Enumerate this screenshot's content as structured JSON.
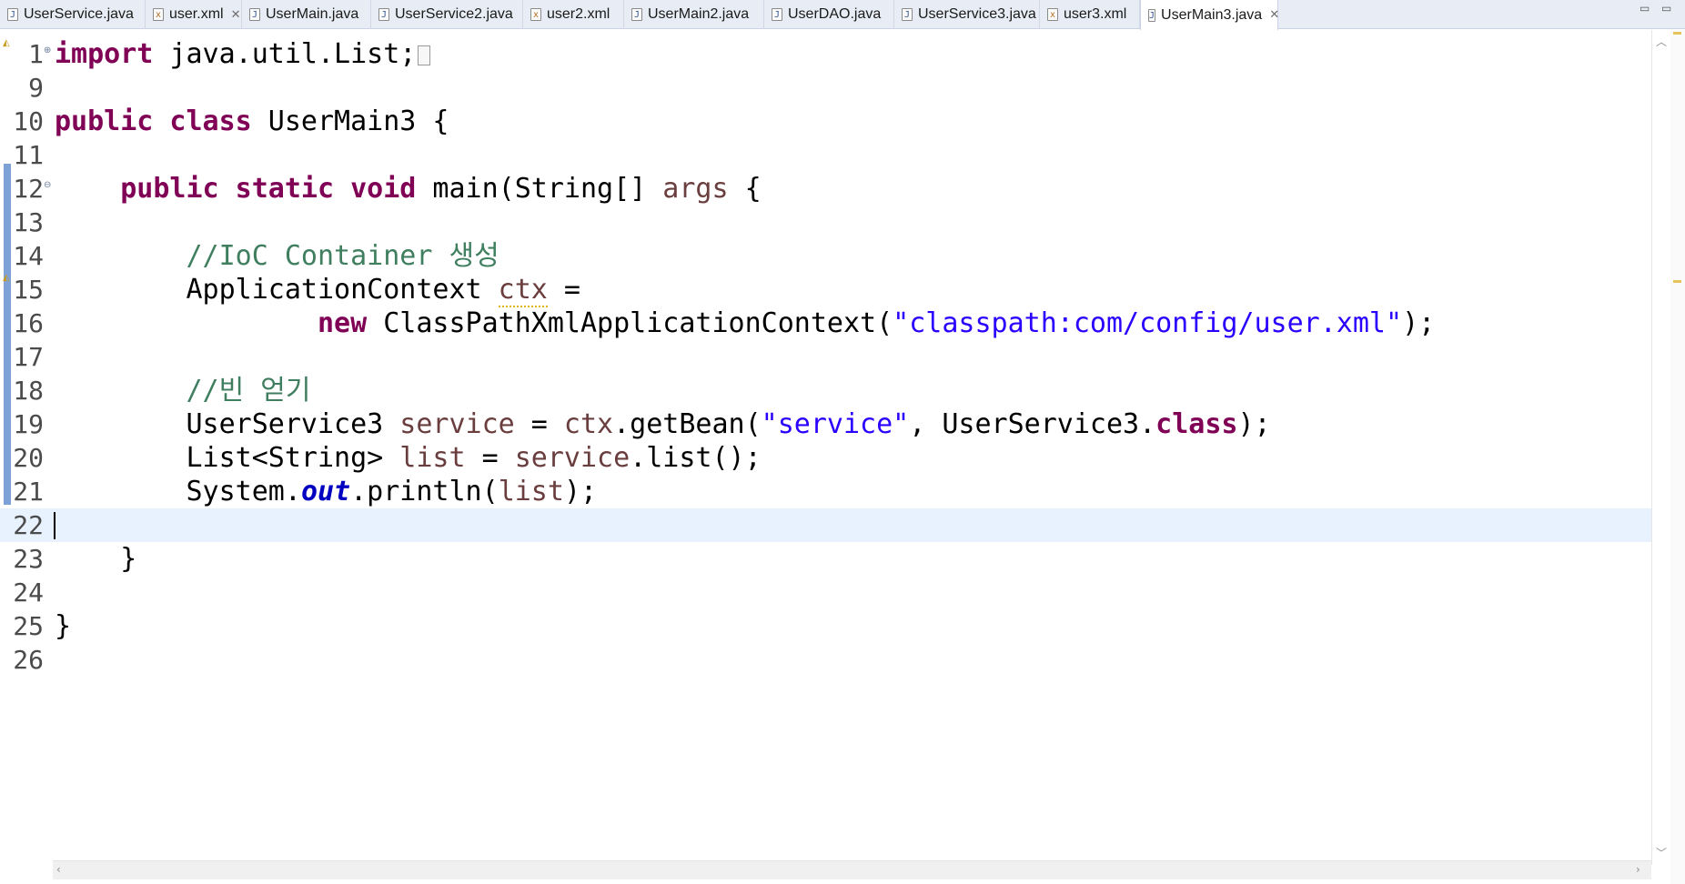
{
  "tabs": [
    {
      "label": "UserService.java",
      "icon": "java-file-icon",
      "active": false
    },
    {
      "label": "user.xml",
      "icon": "xml-file-icon",
      "active": false,
      "close": "✕"
    },
    {
      "label": "UserMain.java",
      "icon": "java-file-icon",
      "active": false
    },
    {
      "label": "UserService2.java",
      "icon": "java-file-icon",
      "active": false
    },
    {
      "label": "user2.xml",
      "icon": "xml-file-icon",
      "active": false
    },
    {
      "label": "UserMain2.java",
      "icon": "java-file-icon",
      "active": false
    },
    {
      "label": "UserDAO.java",
      "icon": "java-file-icon",
      "active": false
    },
    {
      "label": "UserService3.java",
      "icon": "java-file-icon",
      "active": false
    },
    {
      "label": "user3.xml",
      "icon": "xml-file-icon",
      "active": false
    },
    {
      "label": "UserMain3.java",
      "icon": "java-file-icon",
      "active": true,
      "close": "✕"
    }
  ],
  "editor": {
    "current_line": "22",
    "lines": [
      {
        "n": "1",
        "tokens": [
          [
            "kw",
            "import"
          ],
          [
            "",
            "java.util.List;"
          ]
        ]
      },
      {
        "n": "9",
        "tokens": []
      },
      {
        "n": "10",
        "tokens": [
          [
            "kw",
            "public class"
          ],
          [
            "",
            " UserMain3 {"
          ]
        ]
      },
      {
        "n": "11",
        "tokens": []
      },
      {
        "n": "12",
        "tokens": [
          [
            "",
            "    "
          ],
          [
            "kw",
            "public static void"
          ],
          [
            "",
            " main(String[] "
          ],
          [
            "loc",
            "args"
          ],
          [
            "",
            " {"
          ]
        ]
      },
      {
        "n": "13",
        "tokens": []
      },
      {
        "n": "14",
        "tokens": [
          [
            "",
            "        "
          ],
          [
            "cmt",
            "//IoC Container 생성"
          ]
        ]
      },
      {
        "n": "15",
        "tokens": [
          [
            "",
            "        ApplicationContext "
          ],
          [
            "loc warn",
            "ctx"
          ],
          [
            "",
            " ="
          ]
        ]
      },
      {
        "n": "16",
        "tokens": [
          [
            "",
            "                "
          ],
          [
            "kw",
            "new"
          ],
          [
            "",
            " ClassPathXmlApplicationContext("
          ],
          [
            "str",
            "\"classpath:com/config/user.xml\""
          ],
          [
            "",
            ");"
          ]
        ]
      },
      {
        "n": "17",
        "tokens": []
      },
      {
        "n": "18",
        "tokens": [
          [
            "",
            "        "
          ],
          [
            "cmt",
            "//빈 얻기"
          ]
        ]
      },
      {
        "n": "19",
        "tokens": [
          [
            "",
            "        UserService3 "
          ],
          [
            "loc",
            "service"
          ],
          [
            "",
            " = "
          ],
          [
            "loc",
            "ctx"
          ],
          [
            "",
            ".getBean("
          ],
          [
            "str",
            "\"service\""
          ],
          [
            "",
            ", UserService3."
          ],
          [
            "kw",
            "class"
          ],
          [
            "",
            ");"
          ]
        ]
      },
      {
        "n": "20",
        "tokens": [
          [
            "",
            "        List<String> "
          ],
          [
            "loc",
            "list"
          ],
          [
            "",
            " = "
          ],
          [
            "loc",
            "service"
          ],
          [
            "",
            ".list();"
          ]
        ]
      },
      {
        "n": "21",
        "tokens": [
          [
            "",
            "        System."
          ],
          [
            "fld",
            "out"
          ],
          [
            "",
            ".println("
          ],
          [
            "loc",
            "list"
          ],
          [
            "",
            ");"
          ]
        ]
      },
      {
        "n": "22",
        "tokens": []
      },
      {
        "n": "23",
        "tokens": [
          [
            "",
            "    }"
          ]
        ]
      },
      {
        "n": "24",
        "tokens": []
      },
      {
        "n": "25",
        "tokens": [
          [
            "",
            "}"
          ]
        ]
      },
      {
        "n": "26",
        "tokens": []
      }
    ]
  },
  "colors": {
    "keyword": "#7f0055",
    "string": "#2a00ff",
    "comment": "#3f7f5f",
    "local_variable": "#6a3e3e",
    "static_field": "#0000c0",
    "current_line_bg": "#e8f2fe",
    "change_bar": "#7ea2d8"
  }
}
